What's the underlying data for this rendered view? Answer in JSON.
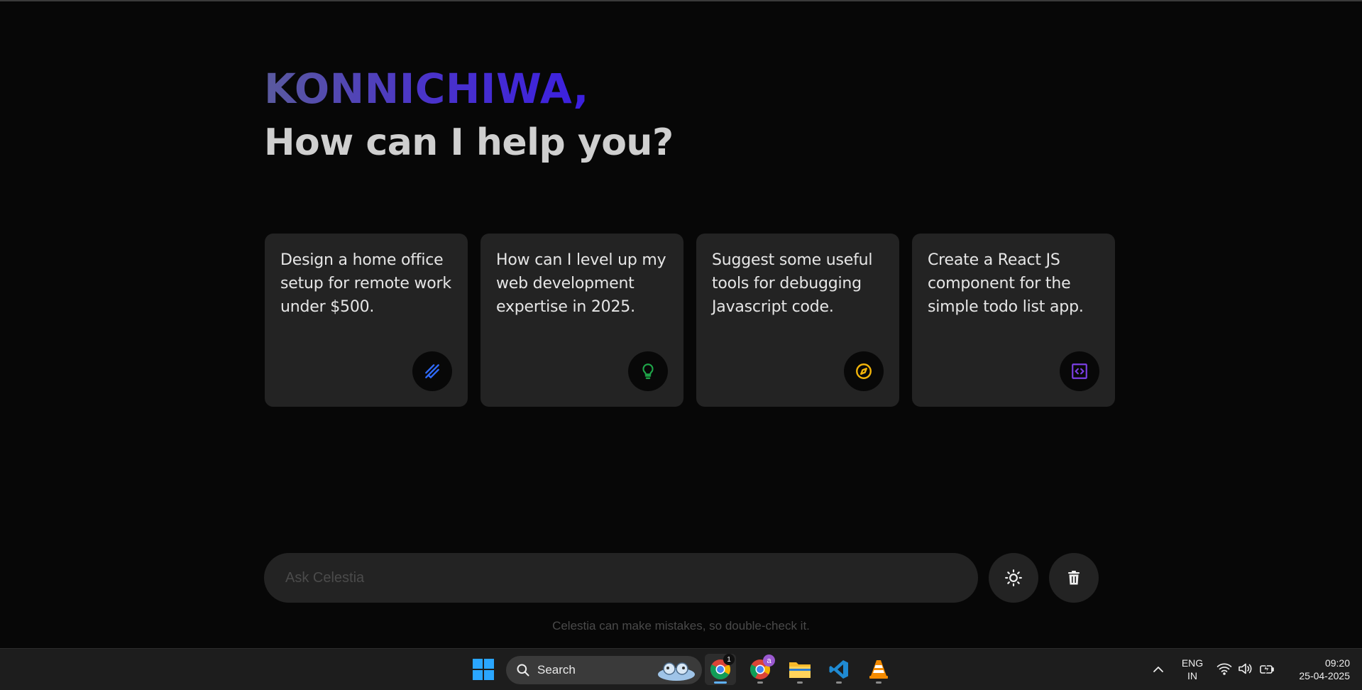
{
  "greeting": "KONNICHIWA,",
  "subtitle": "How can I help you?",
  "cards": [
    {
      "text": "Design a home office setup for remote work under $500.",
      "icon": "pen-ruler-icon",
      "icon_color": "#2f6bff"
    },
    {
      "text": "How can I level up my web development expertise in 2025.",
      "icon": "lightbulb-icon",
      "icon_color": "#1fa84a"
    },
    {
      "text": "Suggest some useful tools for debugging Javascript code.",
      "icon": "compass-icon",
      "icon_color": "#f2b40a"
    },
    {
      "text": "Create a React JS component for the simple todo list app.",
      "icon": "code-icon",
      "icon_color": "#7b3fe4"
    }
  ],
  "prompt": {
    "placeholder": "Ask Celestia"
  },
  "theme_button_icon": "sun-icon",
  "delete_button_icon": "trash-icon",
  "disclaimer": "Celestia can make mistakes, so double-check it.",
  "taskbar": {
    "search_label": "Search",
    "apps": [
      "chrome",
      "chrome-profile",
      "file-explorer",
      "vscode",
      "vlc"
    ],
    "chrome_badge": "1",
    "profile_badge": "a",
    "language": "ENG",
    "region": "IN",
    "time": "09:20",
    "date": "25-04-2025"
  },
  "colors": {
    "background": "#070707",
    "card": "#232323",
    "greeting_start": "#5a5a9e",
    "greeting_end": "#3b1fe0"
  }
}
